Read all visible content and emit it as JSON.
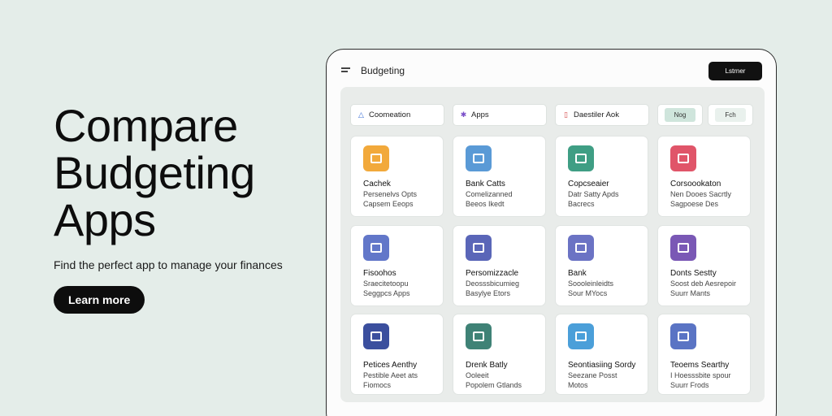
{
  "hero": {
    "title": "Compare\nBudgeting\nApps",
    "subtitle": "Find the perfect app to manage your finances",
    "cta": "Learn more"
  },
  "app": {
    "title": "Budgeting",
    "header_button": "Lstrner"
  },
  "filters": [
    {
      "label": "Coomeation",
      "icon": "triangle-icon",
      "color": "#3b6fd6"
    },
    {
      "label": "Apps",
      "icon": "sparkle-icon",
      "color": "#7a4fc9"
    },
    {
      "label": "Daestiler Aok",
      "icon": "doc-icon",
      "color": "#d44a4a"
    }
  ],
  "chips": [
    {
      "label": "Nog",
      "bg": "#cfe5dc"
    },
    {
      "label": "Fch",
      "bg": "#e9f1ed"
    }
  ],
  "cards": [
    {
      "title": "Cachek",
      "lines": [
        "Persenelvs Opts",
        "Capsem Eeops"
      ],
      "color": "#f2a93b",
      "icon": "chart-icon",
      "three": false
    },
    {
      "title": "Bank Catts",
      "lines": [
        "Comelizanned",
        "Beeos Ikedt"
      ],
      "color": "#5a9ad6",
      "icon": "wallet-icon",
      "three": false
    },
    {
      "title": "Copcseaier",
      "lines": [
        "Datr Satty Apds",
        "Bacrecs"
      ],
      "color": "#3f9e84",
      "icon": "box-icon",
      "three": false
    },
    {
      "title": "Corsoookaton",
      "lines": [
        "Nen Dooes Sacrtly",
        "Sagpoese Des"
      ],
      "color": "#e05569",
      "icon": "receipt-icon",
      "three": false
    },
    {
      "title": "Fisoohos",
      "lines": [
        "Sraecitetoopu",
        "Seggpcs Apps"
      ],
      "color": "#6277c9",
      "icon": "card-icon",
      "three": false
    },
    {
      "title": "Persomizzacle",
      "lines": [
        "Deosssbicumieg",
        "Basylye Etors"
      ],
      "color": "#5a66b8",
      "icon": "image-icon",
      "three": false
    },
    {
      "title": "Bank",
      "lines": [
        "Soooleinleidts",
        "Sour MYocs"
      ],
      "color": "#6b73c4",
      "icon": "calc-icon",
      "three": false
    },
    {
      "title": "Donts Sestty",
      "lines": [
        "Soost deb Aesrepoir",
        "Suurr Mants"
      ],
      "color": "#7a58b5",
      "icon": "lock-icon",
      "three": false
    },
    {
      "title": "Petices Aenthy",
      "lines": [
        "Pestible Aeet ats",
        "Fiomocs"
      ],
      "color": "#3b4f9e",
      "icon": "flag-icon",
      "three": true,
      "three_title_row2": false
    },
    {
      "title": "Drenk Batly",
      "lines": [
        "Ooleeit",
        "Popolem Gtlands"
      ],
      "color": "#3f8276",
      "icon": "cancel-icon",
      "three": true
    },
    {
      "title": "Seontiasiing Sordy",
      "lines": [
        "Seezane Posst",
        "Motos"
      ],
      "color": "#4b9fd9",
      "icon": "screen-icon",
      "three": true
    },
    {
      "title": "Teoems Searthy",
      "lines": [
        "I Hoesssbite spour",
        "Suurr Frods"
      ],
      "color": "#5a74c4",
      "icon": "page-icon",
      "three": true
    }
  ]
}
